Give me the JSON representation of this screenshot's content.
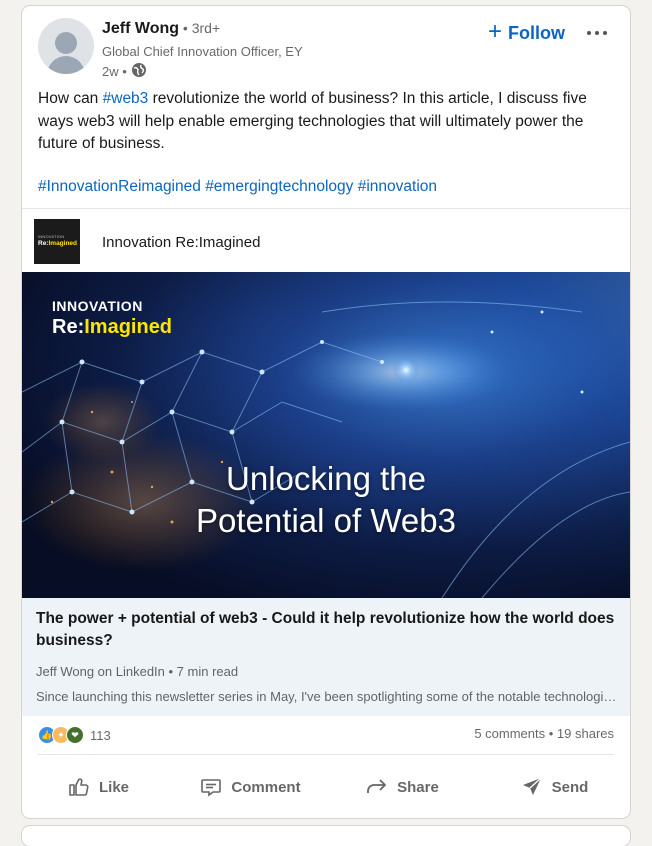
{
  "post": {
    "author_name": "Jeff Wong",
    "degree": " • 3rd+",
    "headline": "Global Chief Innovation Officer, EY",
    "time": "2w •",
    "follow_label": "Follow",
    "text_prefix": "How can ",
    "text_hashtag": "#web3",
    "text_body": " revolutionize the world of business? In this article, I discuss five ways web3 will help enable emerging technologies that will ultimately power the future of business.",
    "hashtags": [
      "#InnovationReimagined",
      "#emergingtechnology",
      "#innovation"
    ]
  },
  "newsletter": {
    "logo_line1": "INNOVATION",
    "logo_line2a": "Re:",
    "logo_line2b": "Imagined",
    "title": "Innovation Re:Imagined"
  },
  "article": {
    "image_brand_line1": "INNOVATION",
    "image_brand_line2a": "Re:",
    "image_brand_line2b": "Imagined",
    "image_title_line1": "Unlocking the",
    "image_title_line2": "Potential of Web3",
    "title": "The power + potential of web3 - Could it help revolutionize how the world does business?",
    "byline": "Jeff Wong on LinkedIn • 7 min read",
    "snippet": "Since launching this newsletter series in May, I've been spotlighting some of the notable technologies..."
  },
  "social": {
    "reactions_count": "113",
    "comments": "5 comments",
    "separator": " • ",
    "shares": "19 shares",
    "reaction_icons": [
      "like-icon",
      "celebrate-icon",
      "support-icon"
    ]
  },
  "actions": {
    "like": "Like",
    "comment": "Comment",
    "share": "Share",
    "send": "Send"
  },
  "colors": {
    "link": "#0a66c2",
    "background": "#f3f2ef"
  }
}
